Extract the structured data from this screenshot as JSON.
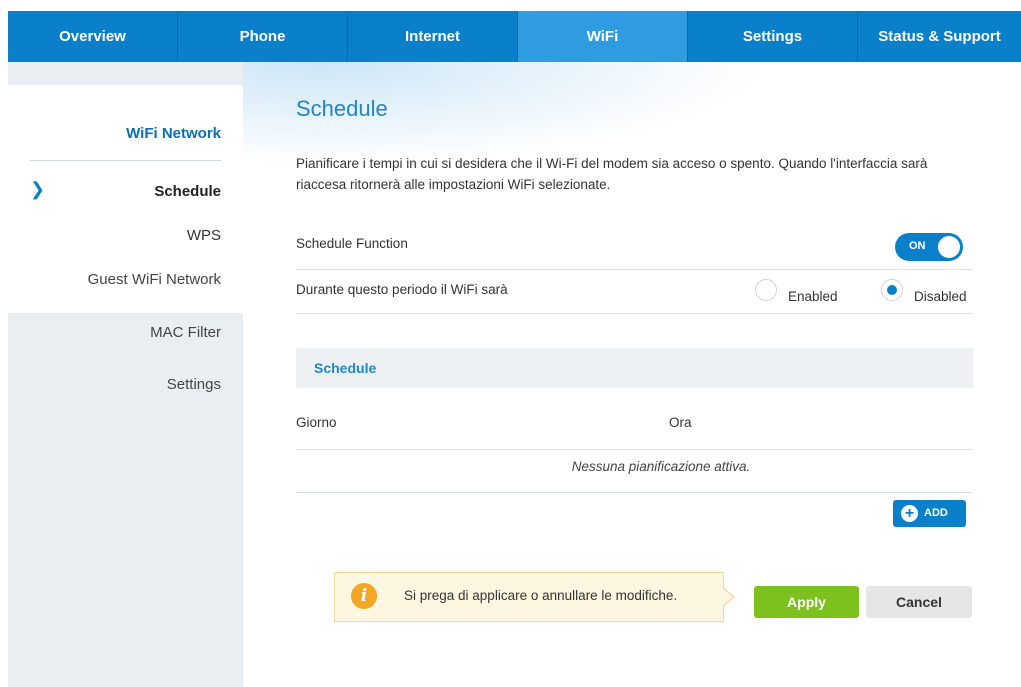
{
  "nav": {
    "tabs": [
      "Overview",
      "Phone",
      "Internet",
      "WiFi",
      "Settings",
      "Status & Support"
    ],
    "active": "WiFi"
  },
  "sidebar": {
    "group_title": "WiFi Network",
    "items": [
      "Schedule",
      "WPS",
      "Guest WiFi Network",
      "MAC Filter",
      "Settings"
    ],
    "active": "Schedule"
  },
  "page": {
    "title": "Schedule",
    "description": "Pianificare i tempi in cui si desidera che il Wi-Fi del modem sia acceso o spento. Quando l'interfaccia sarà riaccesa ritornerà alle impostazioni WiFi selezionate."
  },
  "schedule_function": {
    "label": "Schedule Function",
    "toggle_label": "ON",
    "state": "on"
  },
  "wifi_period": {
    "label": "Durante questo periodo il WiFi sarà",
    "options": [
      "Enabled",
      "Disabled"
    ],
    "selected": "Disabled"
  },
  "schedule_table": {
    "title": "Schedule",
    "columns": [
      "Giorno",
      "Ora"
    ],
    "empty_message": "Nessuna pianificazione attiva."
  },
  "add_button": {
    "label": "ADD"
  },
  "notice": {
    "text": "Si prega di applicare o annullare le modifiche."
  },
  "actions": {
    "apply": "Apply",
    "cancel": "Cancel"
  },
  "colors": {
    "primary": "#0a80cb",
    "active_tab": "#2f9be0",
    "apply": "#7cc11e",
    "info": "#f5a623"
  }
}
